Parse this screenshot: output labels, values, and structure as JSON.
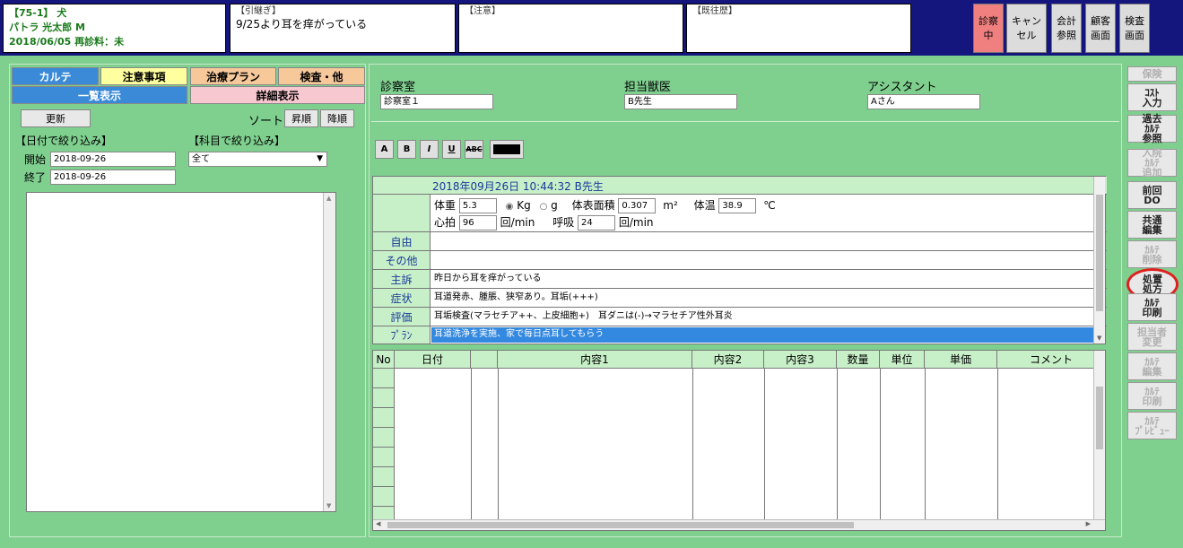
{
  "patient": {
    "line1": "【75-1】 犬",
    "line2": "パトラ 光太郎 M",
    "line3": "2018/06/05 再診料：未"
  },
  "handover": {
    "label": "【引継ぎ】",
    "value": "9/25より耳を痒がっている"
  },
  "caution": {
    "label": "【注意】",
    "value": ""
  },
  "history": {
    "label": "【既往歴】",
    "value": ""
  },
  "header_buttons": [
    {
      "label": "診察\n中"
    },
    {
      "label": "キャン\nセル"
    },
    {
      "label": "会計\n参照"
    },
    {
      "label": "顧客\n画面"
    },
    {
      "label": "検査\n画面"
    }
  ],
  "left": {
    "tabs": [
      "カルテ",
      "注意事項",
      "治療プラン",
      "検査・他"
    ],
    "view_tabs": [
      "一覧表示",
      "詳細表示"
    ],
    "refresh": "更新",
    "sort_label": "ソート",
    "sort_asc": "昇順",
    "sort_desc": "降順",
    "date_filter_label": "【日付で絞り込み】",
    "subject_filter_label": "【科目で絞り込み】",
    "start_label": "開始",
    "start_value": "2018-09-26",
    "end_label": "終了",
    "end_value": "2018-09-26",
    "subject_value": "全て"
  },
  "main": {
    "room_label": "診察室",
    "room_value": "診察室１",
    "vet_label": "担当獣医",
    "vet_value": "B先生",
    "assistant_label": "アシスタント",
    "assistant_value": "Aさん",
    "format_buttons": [
      "A",
      "B",
      "I",
      "U",
      "ABC"
    ],
    "record_header": "2018年09月26日 10:44:32 B先生",
    "weight_label": "体重",
    "weight_value": "5.3",
    "unit_kg": "Kg",
    "unit_g": "g",
    "bsa_label": "体表面積",
    "bsa_value": "0.307",
    "bsa_unit": "m²",
    "temp_label": "体温",
    "temp_value": "38.9",
    "temp_unit": "℃",
    "hr_label": "心拍",
    "hr_value": "96",
    "hr_unit": "回/min",
    "resp_label": "呼吸",
    "resp_value": "24",
    "resp_unit": "回/min",
    "rows": [
      {
        "label": "自由",
        "value": ""
      },
      {
        "label": "その他",
        "value": ""
      },
      {
        "label": "主訴",
        "value": "昨日から耳を痒がっている"
      },
      {
        "label": "症状",
        "value": "耳道発赤、腫脹、狭窄あり。耳垢(+++)"
      },
      {
        "label": "評価",
        "value": "耳垢検査(マラセチア++、上皮細胞+)　耳ダニは(-)→マラセチア性外耳炎"
      },
      {
        "label": "ﾌﾟﾗﾝ",
        "value": "耳道洗浄を実施、家で毎日点耳してもらう"
      }
    ],
    "rx_columns": [
      "No",
      "日付",
      "",
      "内容1",
      "内容2",
      "内容3",
      "数量",
      "単位",
      "単価",
      "コメント"
    ]
  },
  "sidebar": [
    {
      "label": "保険",
      "state": "dis"
    },
    {
      "label": "ｺｽﾄ\n入力",
      "state": "on"
    },
    {
      "label": "過去\nｶﾙﾃ\n参照",
      "state": "on"
    },
    {
      "label": "入院\nｶﾙﾃ\n追加",
      "state": "dis"
    },
    {
      "label": "前回\nDO",
      "state": "on"
    },
    {
      "label": "共通\n編集",
      "state": "on"
    },
    {
      "label": "ｶﾙﾃ\n削除",
      "state": "dis"
    },
    {
      "label": "処置\n処方",
      "state": "on"
    },
    {
      "label": "ｶﾙﾃ\n印刷",
      "state": "on"
    },
    {
      "label": "担当者\n変更",
      "state": "dis"
    },
    {
      "label": "ｶﾙﾃ\n編集",
      "state": "dis"
    },
    {
      "label": "ｶﾙﾃ\n印刷",
      "state": "dis"
    },
    {
      "label": "ｶﾙﾃ\nﾌﾟﾚﾋﾞｭｰ",
      "state": "dis"
    }
  ]
}
